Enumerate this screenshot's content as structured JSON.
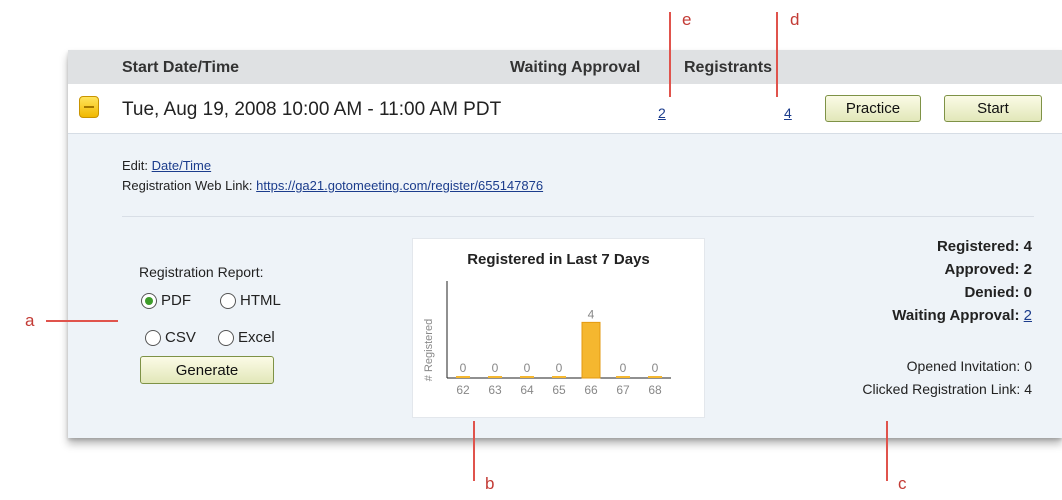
{
  "header": {
    "start_col": "Start Date/Time",
    "waiting_col": "Waiting Approval",
    "registrants_col": "Registrants"
  },
  "session": {
    "datetime": "Tue, Aug 19, 2008 10:00 AM - 11:00 AM PDT",
    "waiting_count": "2",
    "registrants_count": "4",
    "practice_label": "Practice",
    "start_label": "Start"
  },
  "details": {
    "edit_prefix": "Edit:",
    "edit_link": "Date/Time",
    "reg_link_prefix": "Registration Web Link:",
    "reg_link": "https://ga21.gotomeeting.com/register/655147876"
  },
  "report": {
    "label": "Registration Report:",
    "options": [
      {
        "label": "PDF",
        "checked": true
      },
      {
        "label": "HTML",
        "checked": false
      },
      {
        "label": "CSV",
        "checked": false
      },
      {
        "label": "Excel",
        "checked": false
      }
    ],
    "generate_label": "Generate"
  },
  "chart_data": {
    "type": "bar",
    "title": "Registered in Last 7 Days",
    "ylabel": "# Registered",
    "xlabel": "",
    "categories": [
      "62",
      "63",
      "64",
      "65",
      "66",
      "67",
      "68"
    ],
    "values": [
      0,
      0,
      0,
      0,
      4,
      0,
      0
    ],
    "bar_color": "#f5b72f"
  },
  "stats": {
    "registered_label": "Registered:",
    "registered": "4",
    "approved_label": "Approved:",
    "approved": "2",
    "denied_label": "Denied:",
    "denied": "0",
    "waiting_label": "Waiting Approval:",
    "waiting": "2",
    "opened_label": "Opened Invitation:",
    "opened": "0",
    "clicked_label": "Clicked Registration Link:",
    "clicked": "4"
  },
  "callouts": {
    "a": "a",
    "b": "b",
    "c": "c",
    "d": "d",
    "e": "e"
  },
  "colors": {
    "callout": "#e0534c",
    "link": "#1b3c8c",
    "accent_bar": "#f5b72f"
  }
}
